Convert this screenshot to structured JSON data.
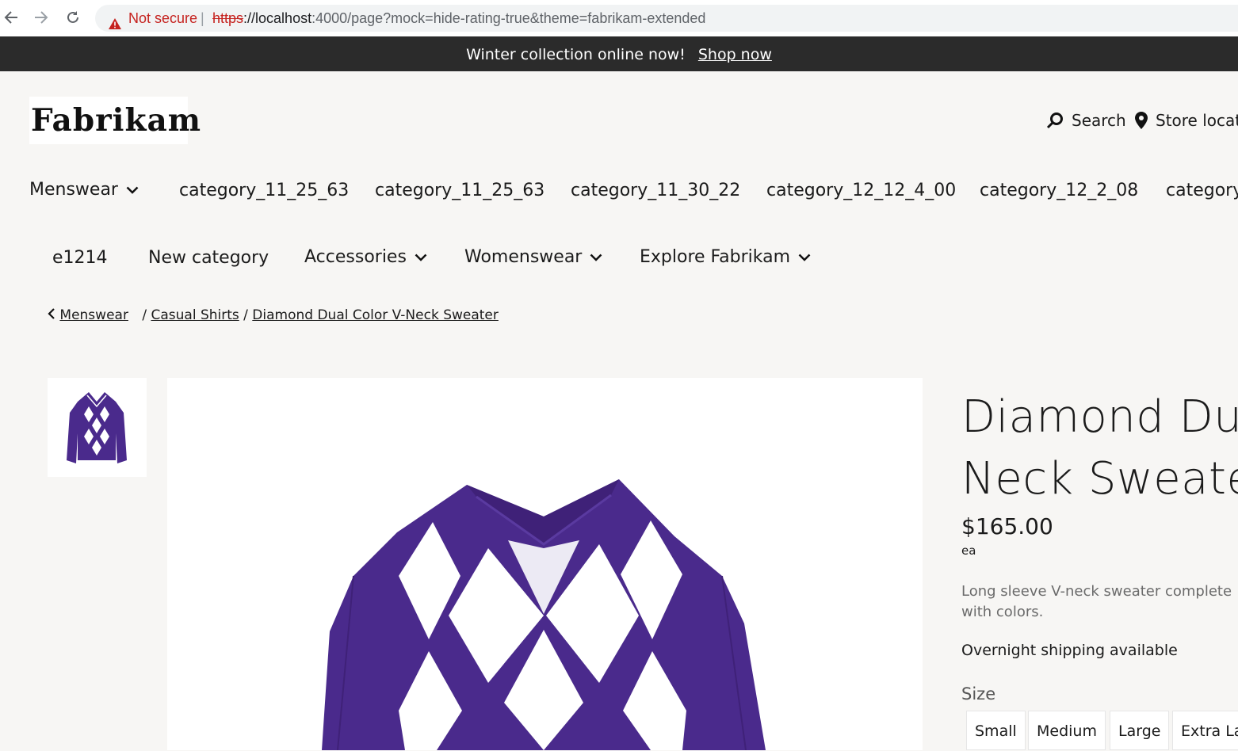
{
  "browser": {
    "security_label": "Not secure",
    "url_scheme": "https",
    "url_host": "://localhost",
    "url_rest": ":4000/page?mock=hide-rating-true&theme=fabrikam-extended",
    "icons": [
      "back-arrow-icon",
      "forward-arrow-icon",
      "reload-icon",
      "warning-triangle-icon"
    ]
  },
  "promo": {
    "text": "Winter collection online now!",
    "link": "Shop now"
  },
  "header": {
    "logo": "Fabrikam",
    "search_label": "Search",
    "store_locator_label": "Store locato"
  },
  "nav": {
    "row1": [
      "Menswear",
      "category_11_25_63",
      "category_11_25_63",
      "category_11_30_22",
      "category_12_12_4_00",
      "category_12_2_08",
      "category_"
    ],
    "row2": [
      "e1214",
      "New category",
      "Accessories",
      "Womenswear",
      "Explore Fabrikam"
    ]
  },
  "breadcrumb": {
    "items": [
      "Menswear",
      "Casual Shirts",
      "Diamond Dual Color V-Neck Sweater"
    ],
    "separator": "/"
  },
  "product": {
    "title_line1": "Diamond Dua",
    "title_line2": "Neck Sweater",
    "price": "$165.00",
    "unit": "ea",
    "description": "Long sleeve V-neck sweater complete with colors.",
    "shipping": "Overnight shipping available",
    "size_label": "Size",
    "sizes": [
      "Small",
      "Medium",
      "Large",
      "Extra Lar"
    ]
  },
  "colors": {
    "banner_bg": "#2b2b2b",
    "page_bg": "#f7f6f4",
    "sweater_purple": "#4a2a8c",
    "warning_red": "#c5221f"
  }
}
